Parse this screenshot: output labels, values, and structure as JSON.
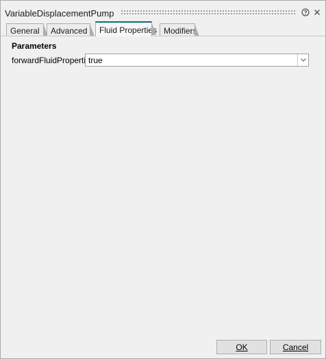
{
  "window": {
    "title": "VariableDisplacementPump",
    "help_icon": "help-circle-icon",
    "close_icon": "close-icon"
  },
  "tabs": [
    {
      "label": "General",
      "active": false
    },
    {
      "label": "Advanced",
      "active": false
    },
    {
      "label": "Fluid Properties",
      "active": true
    },
    {
      "label": "Modifiers",
      "active": false
    }
  ],
  "parameters": {
    "heading": "Parameters",
    "fields": [
      {
        "label": "forwardFluidProperties",
        "value": "true",
        "control": "dropdown",
        "icon": "chevron-down-icon"
      }
    ]
  },
  "footer": {
    "ok_label": "OK",
    "cancel_label": "Cancel"
  }
}
